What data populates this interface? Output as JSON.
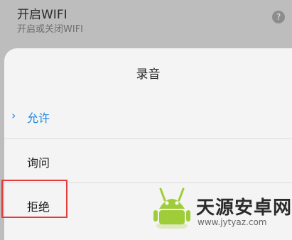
{
  "background_setting": {
    "title": "开启WIFI",
    "subtitle": "开启或关闭WIFI",
    "help_glyph": "?"
  },
  "dialog": {
    "title": "录音",
    "options": [
      {
        "label": "允许",
        "selected": true
      },
      {
        "label": "询问",
        "selected": false
      },
      {
        "label": "拒绝",
        "selected": false
      }
    ],
    "selected_marker": "›"
  },
  "watermark": {
    "name": "天源安卓网",
    "url": "www.jytyaz.com"
  },
  "colors": {
    "accent": "#1f86e0",
    "highlight": "#e43a3a",
    "android_green": "#9fcd3a"
  }
}
